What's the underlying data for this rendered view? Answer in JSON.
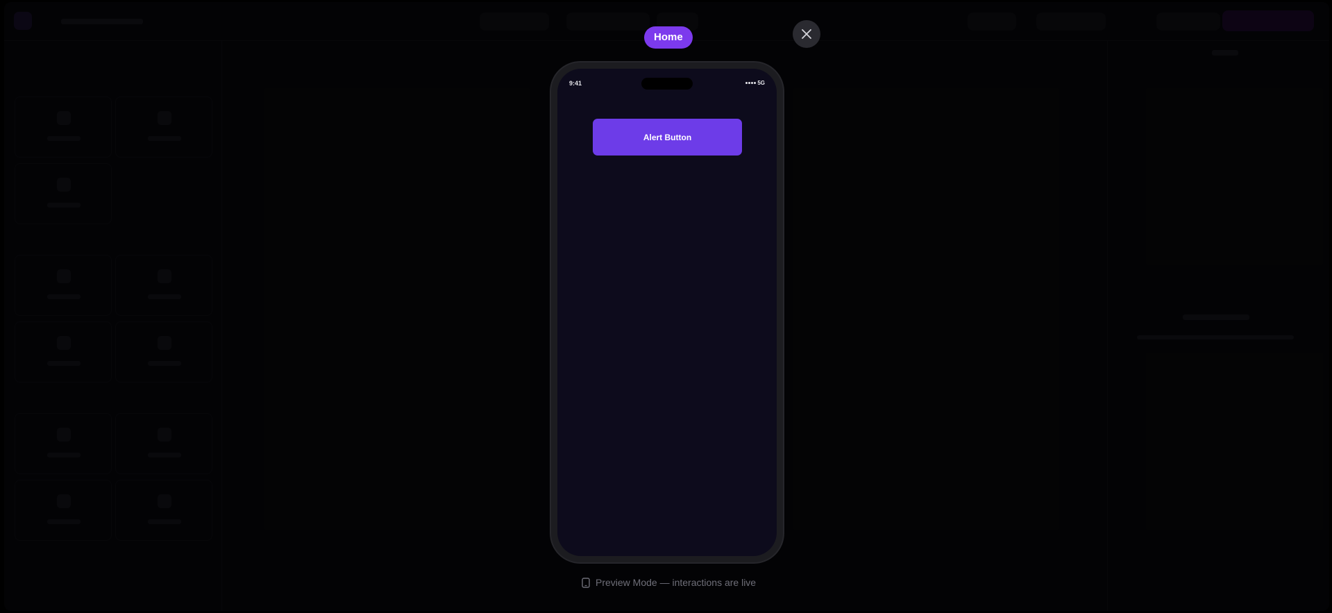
{
  "preview": {
    "screen_name": "Home",
    "close_icon": "close-icon",
    "phone": {
      "status_time": "9:41",
      "network": "5G",
      "signal_icon": "signal-dots-icon",
      "alert_button_label": "Alert Button"
    },
    "caption": "Preview Mode — interactions are live",
    "caption_icon": "phone-icon"
  },
  "colors": {
    "accent": "#7c3aed",
    "button": "#6d3ce8",
    "phone_screen_bg": "#0d0b1c",
    "backdrop": "#000000"
  }
}
